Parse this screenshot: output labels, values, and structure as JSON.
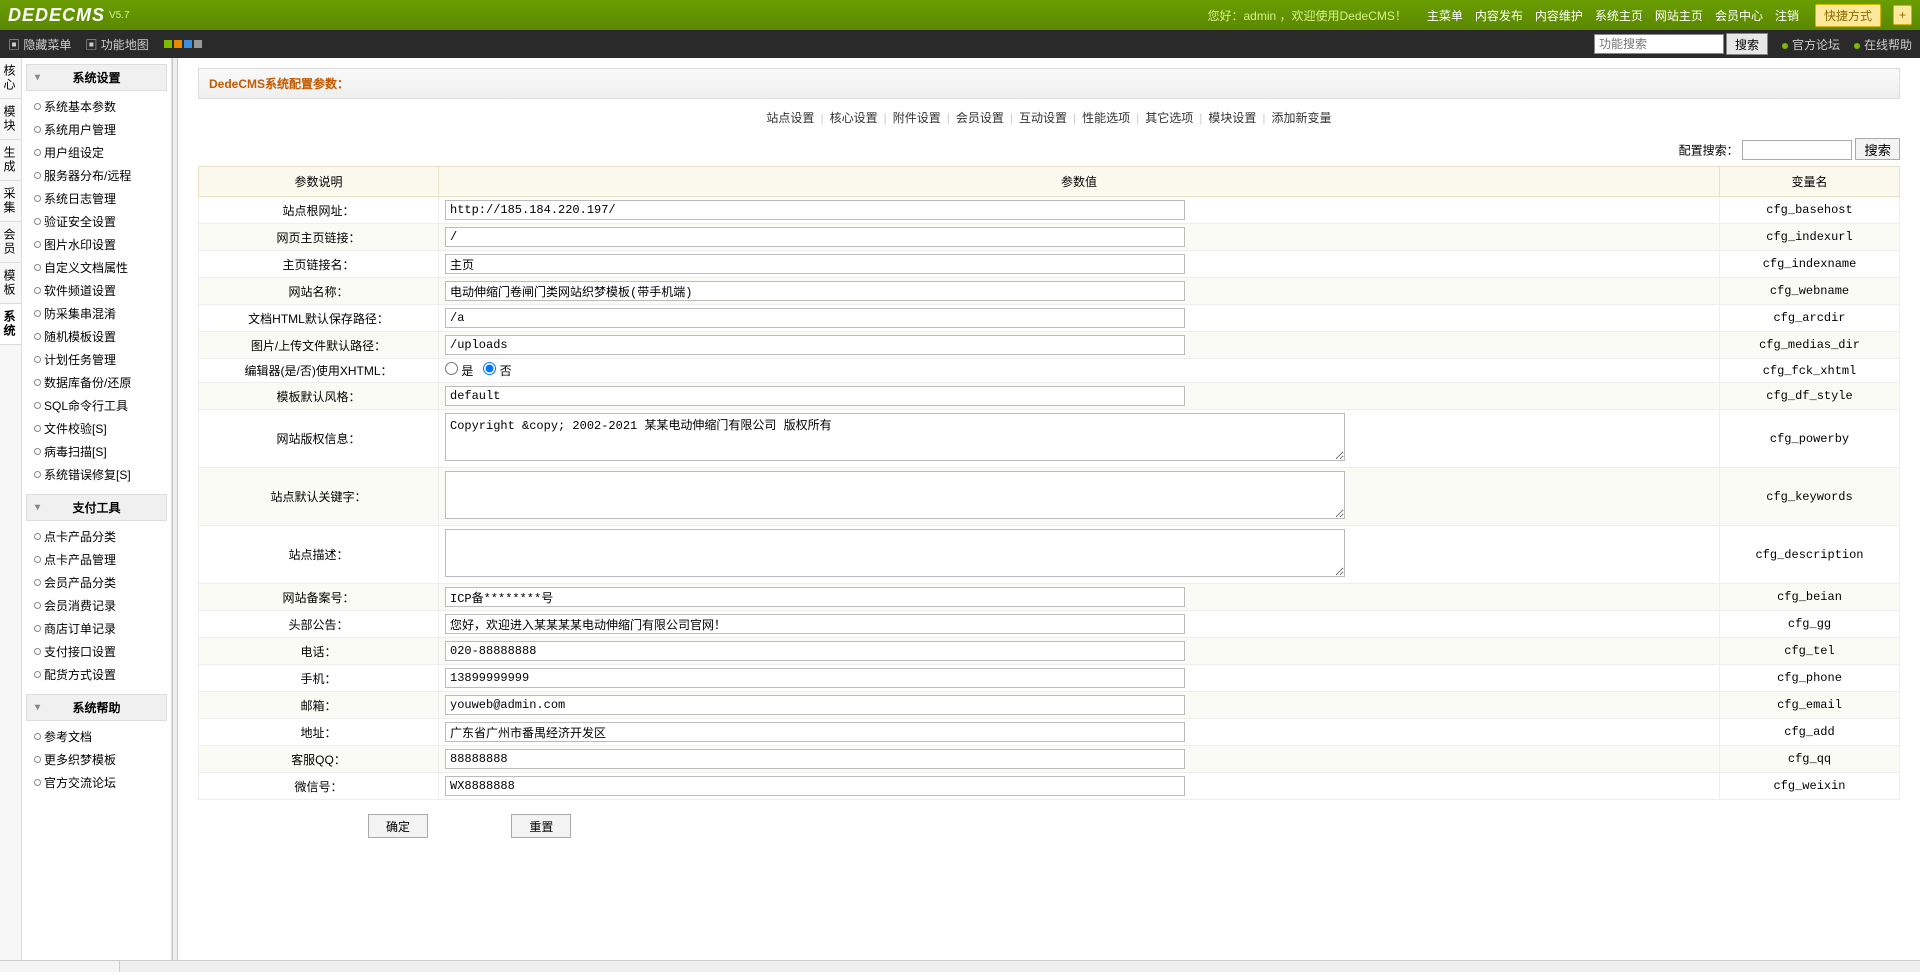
{
  "header": {
    "logo_main": "DEDECMS",
    "logo_ver": "V5.7",
    "welcome": "您好：admin ，欢迎使用DedeCMS！",
    "menu": [
      "主菜单",
      "内容发布",
      "内容维护",
      "系统主页",
      "网站主页",
      "会员中心",
      "注销"
    ],
    "quick_label": "快捷方式",
    "plus": "+"
  },
  "subheader": {
    "hide_menu": "隐藏菜单",
    "func_map": "功能地图",
    "search_placeholder": "功能搜索",
    "search_btn": "搜索",
    "forum": "官方论坛",
    "help": "在线帮助"
  },
  "nav_col": [
    "核心",
    "模块",
    "生成",
    "采集",
    "会员",
    "模板",
    "系统"
  ],
  "sidebar": {
    "g1": {
      "title": "系统设置",
      "items": [
        "系统基本参数",
        "系统用户管理",
        "用户组设定",
        "服务器分布/远程",
        "系统日志管理",
        "验证安全设置",
        "图片水印设置",
        "自定义文档属性",
        "软件频道设置",
        "防采集串混淆",
        "随机模板设置",
        "计划任务管理",
        "数据库备份/还原",
        "SQL命令行工具",
        "文件校验[S]",
        "病毒扫描[S]",
        "系统错误修复[S]"
      ]
    },
    "g2": {
      "title": "支付工具",
      "items": [
        "点卡产品分类",
        "点卡产品管理",
        "会员产品分类",
        "会员消费记录",
        "商店订单记录",
        "支付接口设置",
        "配货方式设置"
      ]
    },
    "g3": {
      "title": "系统帮助",
      "items": [
        "参考文档",
        "更多织梦模板",
        "官方交流论坛"
      ]
    }
  },
  "main": {
    "page_title": "DedeCMS系统配置参数：",
    "tabs": [
      "站点设置",
      "核心设置",
      "附件设置",
      "会员设置",
      "互动设置",
      "性能选项",
      "其它选项",
      "模块设置",
      "添加新变量"
    ],
    "sep": "|",
    "config_search_label": "配置搜索：",
    "config_search_btn": "搜索",
    "thead": {
      "desc": "参数说明",
      "value": "参数值",
      "var": "变量名"
    },
    "rows": [
      {
        "desc": "站点根网址：",
        "type": "text",
        "value": "http://185.184.220.197/",
        "var": "cfg_basehost"
      },
      {
        "desc": "网页主页链接：",
        "type": "text",
        "value": "/",
        "var": "cfg_indexurl"
      },
      {
        "desc": "主页链接名：",
        "type": "text",
        "value": "主页",
        "var": "cfg_indexname"
      },
      {
        "desc": "网站名称：",
        "type": "text",
        "value": "电动伸缩门卷闸门类网站织梦模板(带手机端)",
        "var": "cfg_webname"
      },
      {
        "desc": "文档HTML默认保存路径：",
        "type": "text",
        "value": "/a",
        "var": "cfg_arcdir"
      },
      {
        "desc": "图片/上传文件默认路径：",
        "type": "text",
        "value": "/uploads",
        "var": "cfg_medias_dir"
      },
      {
        "desc": "编辑器(是/否)使用XHTML：",
        "type": "radio",
        "value": "否",
        "options": [
          "是",
          "否"
        ],
        "var": "cfg_fck_xhtml"
      },
      {
        "desc": "模板默认风格：",
        "type": "text",
        "value": "default",
        "var": "cfg_df_style"
      },
      {
        "desc": "网站版权信息：",
        "type": "textarea",
        "value": "Copyright &copy; 2002-2021 某某电动伸缩门有限公司 版权所有",
        "var": "cfg_powerby"
      },
      {
        "desc": "站点默认关键字：",
        "type": "textarea",
        "value": "",
        "var": "cfg_keywords"
      },
      {
        "desc": "站点描述：",
        "type": "textarea",
        "value": "",
        "var": "cfg_description"
      },
      {
        "desc": "网站备案号：",
        "type": "text",
        "value": "ICP备********号",
        "var": "cfg_beian"
      },
      {
        "desc": "头部公告：",
        "type": "text",
        "value": "您好，欢迎进入某某某某电动伸缩门有限公司官网！",
        "var": "cfg_gg"
      },
      {
        "desc": "电话：",
        "type": "text",
        "value": "020-88888888",
        "var": "cfg_tel"
      },
      {
        "desc": "手机：",
        "type": "text",
        "value": "13899999999",
        "var": "cfg_phone"
      },
      {
        "desc": "邮箱：",
        "type": "text",
        "value": "youweb@admin.com",
        "var": "cfg_email"
      },
      {
        "desc": "地址：",
        "type": "text",
        "value": "广东省广州市番禺经济开发区",
        "var": "cfg_add"
      },
      {
        "desc": "客服QQ：",
        "type": "text",
        "value": "88888888",
        "var": "cfg_qq"
      },
      {
        "desc": "微信号：",
        "type": "text",
        "value": "WX8888888",
        "var": "cfg_weixin"
      }
    ],
    "btn_ok": "确定",
    "btn_reset": "重置"
  }
}
